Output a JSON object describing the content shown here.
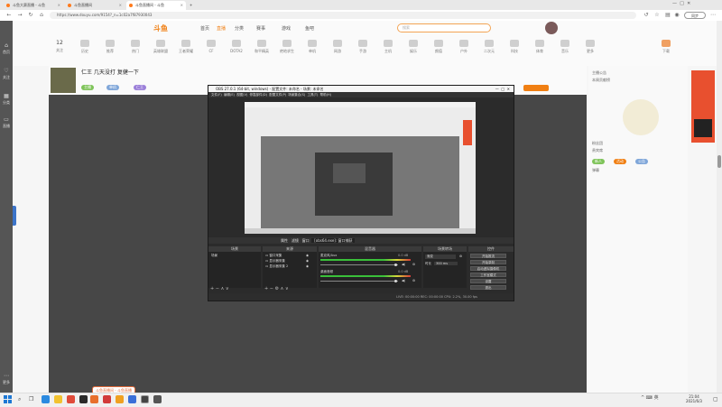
{
  "browser": {
    "tabs": [
      {
        "label": "斗鱼大赛直播 - 斗鱼"
      },
      {
        "label": "斗鱼直播间"
      },
      {
        "label": "斗鱼直播间 - 斗鱼"
      }
    ],
    "url": "https://www.douyu.com/9154?_n=1c02a7f87930043",
    "sync_button": "同步"
  },
  "left_sidebar": {
    "items": [
      {
        "label": "首页"
      },
      {
        "label": "关注"
      },
      {
        "label": "分类"
      },
      {
        "label": "直播"
      },
      {
        "label": "更多"
      }
    ]
  },
  "site": {
    "logo": "斗鱼",
    "nav": [
      "首页",
      "直播",
      "分类",
      "赛事",
      "游戏",
      "鱼吧"
    ],
    "search_placeholder": "搜索",
    "categories": [
      "12",
      "关注",
      "历史",
      "推荐",
      "热门",
      "英雄联盟",
      "王者荣耀",
      "CF",
      "DOTA2",
      "和平精英",
      "绝地求生",
      "单机",
      "网游",
      "手游",
      "主机",
      "娱乐",
      "颜值",
      "户外",
      "二次元",
      "科技",
      "体育",
      "音乐",
      "更多",
      "下载"
    ]
  },
  "room": {
    "title": "仁王 几天没打 复健一下",
    "tags": [
      {
        "text": "主播",
        "color": "#7fc45a"
      },
      {
        "text": "单机",
        "color": "#7fa6d9"
      },
      {
        "text": "仁王",
        "color": "#9b7fd9"
      }
    ]
  },
  "right_panel": {
    "lines": [
      "主播公告",
      "本周贡献榜",
      "粉丝团",
      "贵宾席",
      "弹幕"
    ],
    "badges": [
      "新人",
      "活动",
      "公告"
    ]
  },
  "obs": {
    "title": "OBS 27.0.1 (64-bit, windows) - 配置文件: 未命名 - 场景: 未命名",
    "menu": [
      "文件(F)",
      "编辑(E)",
      "视图(V)",
      "停靠部件(D)",
      "配置文件(P)",
      "场景集合(S)",
      "工具(T)",
      "帮助(H)"
    ],
    "scene_bar": [
      "属性",
      "滤镜",
      "窗口",
      "[obs64.exe]: 窗口捕获"
    ],
    "docks": {
      "scenes": {
        "title": "场景",
        "items": [
          "场景"
        ]
      },
      "sources": {
        "title": "来源",
        "items": [
          "窗口采集",
          "显示器采集",
          "显示器采集 2"
        ]
      },
      "mixer": {
        "title": "混音器",
        "channels": [
          "麦克风/Aux",
          "桌面音频"
        ],
        "level_db": "0.0 dB"
      },
      "transitions": {
        "title": "场景转场",
        "type": "渐变",
        "duration_label": "时长",
        "duration": "300 ms"
      },
      "controls": {
        "title": "控件",
        "buttons": [
          "开始推流",
          "开始录制",
          "启动虚拟摄像机",
          "工作室模式",
          "设置",
          "退出"
        ]
      }
    },
    "status": "LIVE: 00:00:00   REC: 00:00:00   CPU: 2.2%, 30.00 fps"
  },
  "taskbar": {
    "notification": "斗鱼直播间 - 斗鱼直播",
    "time": "21:04",
    "date": "2021/6/3",
    "tray": "^  ⌨  英"
  }
}
